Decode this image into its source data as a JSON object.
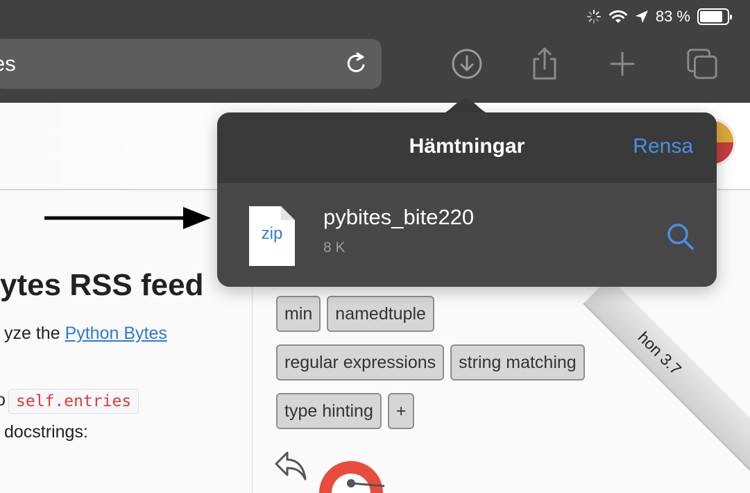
{
  "status_bar": {
    "battery_percent": "83 %",
    "battery_level": 0.83
  },
  "toolbar": {
    "url_text": "es",
    "icons": [
      "reload-icon",
      "download-icon",
      "share-icon",
      "new-tab-icon",
      "tabs-icon"
    ]
  },
  "downloads": {
    "title": "Hämtningar",
    "clear_label": "Rensa",
    "items": [
      {
        "extension": "zip",
        "name": "pybites_bite220",
        "size": "8 K"
      }
    ]
  },
  "page": {
    "title": "ytes RSS feed",
    "para_prefix": "yze the ",
    "para_link": "Python Bytes",
    "code_prefix": "o",
    "code_chip": "self.entries",
    "para2": "docstrings:",
    "tags": [
      [
        "min",
        "namedtuple"
      ],
      [
        "regular expressions",
        "string matching"
      ],
      [
        "type hinting",
        "+"
      ]
    ],
    "ribbon_text": "hon 3.7"
  },
  "colors": {
    "chrome_bg": "#414141",
    "popover_bg": "#3d3d3d",
    "accent_blue": "#4a90e2",
    "link_blue": "#2a7ad8",
    "code_red": "#d43f3a"
  }
}
